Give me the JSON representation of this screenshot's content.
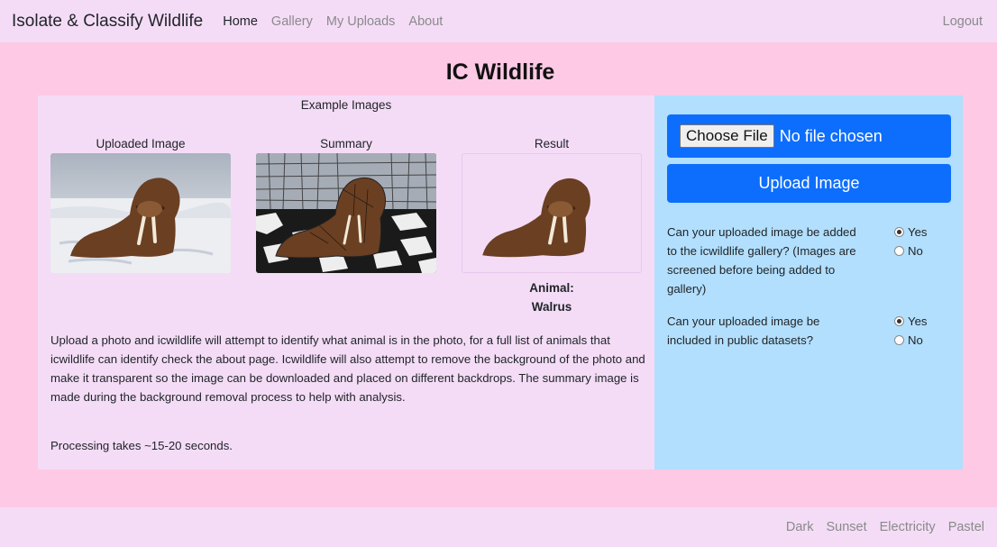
{
  "nav": {
    "brand": "Isolate & Classify Wildlife",
    "links": [
      "Home",
      "Gallery",
      "My Uploads",
      "About"
    ],
    "logout": "Logout"
  },
  "page": {
    "title": "IC Wildlife"
  },
  "examples": {
    "heading": "Example Images",
    "uploaded_label": "Uploaded Image",
    "summary_label": "Summary",
    "result_label": "Result",
    "animal_prefix": "Animal:",
    "animal_name": "Walrus"
  },
  "description": "Upload a photo and icwildlife will attempt to identify what animal is in the photo, for a full list of animals that icwildlife can identify check the about page. Icwildlife will also attempt to remove the background of the photo and make it transparent so the image can be downloaded and placed on different backdrops. The summary image is made during the background removal process to help with analysis.",
  "processing_note": "Processing takes ~15-20 seconds.",
  "upload": {
    "choose_file_label": "Choose File",
    "no_file_text": "No file chosen",
    "upload_button": "Upload Image"
  },
  "questions": [
    {
      "text": "Can your uploaded image be added to the icwildlife gallery? (Images are screened before being added to gallery)",
      "options": [
        "Yes",
        "No"
      ],
      "selected": "Yes"
    },
    {
      "text": "Can your uploaded image be included in public datasets?",
      "options": [
        "Yes",
        "No"
      ],
      "selected": "Yes"
    }
  ],
  "themes": [
    "Dark",
    "Sunset",
    "Electricity",
    "Pastel"
  ],
  "colors": {
    "page_bg": "#fdc9e4",
    "panel_bg": "#f4dcf7",
    "side_bg": "#b2dffd",
    "primary": "#0d6efd"
  }
}
